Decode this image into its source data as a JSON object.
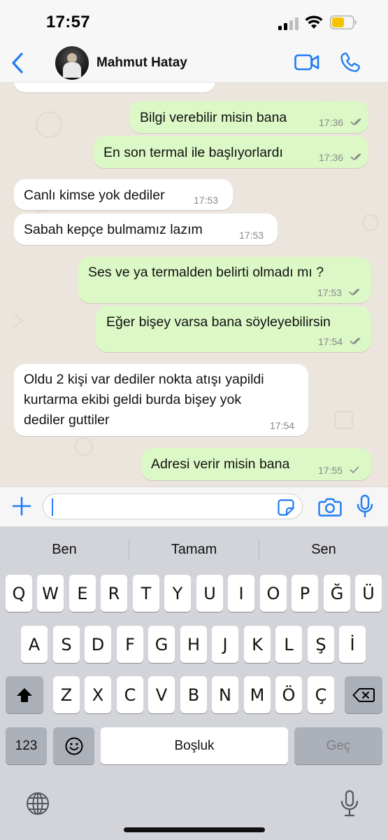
{
  "status_bar": {
    "time": "17:57"
  },
  "header": {
    "contact_name": "Mahmut Hatay"
  },
  "messages": [
    {
      "text": "Bilgi verebilir misin bana",
      "time": "17:36",
      "direction": "out",
      "status": "read"
    },
    {
      "text": "En son termal ile başlıyorlardı",
      "time": "17:36",
      "direction": "out",
      "status": "read"
    },
    {
      "text": "Canlı kimse yok dediler",
      "time": "17:53",
      "direction": "in"
    },
    {
      "text": "Sabah kepçe bulmamız lazım",
      "time": "17:53",
      "direction": "in"
    },
    {
      "text": "Ses ve ya termalden belirti olmadı mı ?",
      "time": "17:53",
      "direction": "out",
      "status": "read"
    },
    {
      "text": "Eğer bişey varsa bana söyleyebilirsin",
      "time": "17:54",
      "direction": "out",
      "status": "read"
    },
    {
      "lines": [
        "Oldu 2 kişi var dediler nokta atışı yapildi",
        "kurtarma ekibi geldi burda bişey yok",
        "dediler guttiler"
      ],
      "time": "17:54",
      "direction": "in"
    },
    {
      "text": "Adresi verir misin bana",
      "time": "17:55",
      "direction": "out",
      "status": "sent"
    }
  ],
  "input": {
    "placeholder": ""
  },
  "keyboard": {
    "suggestions": [
      "Ben",
      "Tamam",
      "Sen"
    ],
    "row1": [
      "Q",
      "W",
      "E",
      "R",
      "T",
      "Y",
      "U",
      "I",
      "O",
      "P",
      "Ğ",
      "Ü"
    ],
    "row2": [
      "A",
      "S",
      "D",
      "F",
      "G",
      "H",
      "J",
      "K",
      "L",
      "Ş",
      "İ"
    ],
    "row3": [
      "Z",
      "X",
      "C",
      "V",
      "B",
      "N",
      "M",
      "Ö",
      "Ç"
    ],
    "numbers_key": "123",
    "space_key": "Boşluk",
    "return_key": "Geç"
  },
  "colors": {
    "accent": "#1f7cf2",
    "outgoing_bubble": "#dcf8c6",
    "incoming_bubble": "#ffffff",
    "chat_background": "#ece5dd",
    "read_ticks": "#8a8a8a"
  },
  "icons": [
    "back-chevron-icon",
    "video-call-icon",
    "phone-icon",
    "plus-icon",
    "sticker-icon",
    "camera-icon",
    "microphone-icon",
    "shift-icon",
    "backspace-icon",
    "emoji-icon",
    "globe-icon"
  ]
}
